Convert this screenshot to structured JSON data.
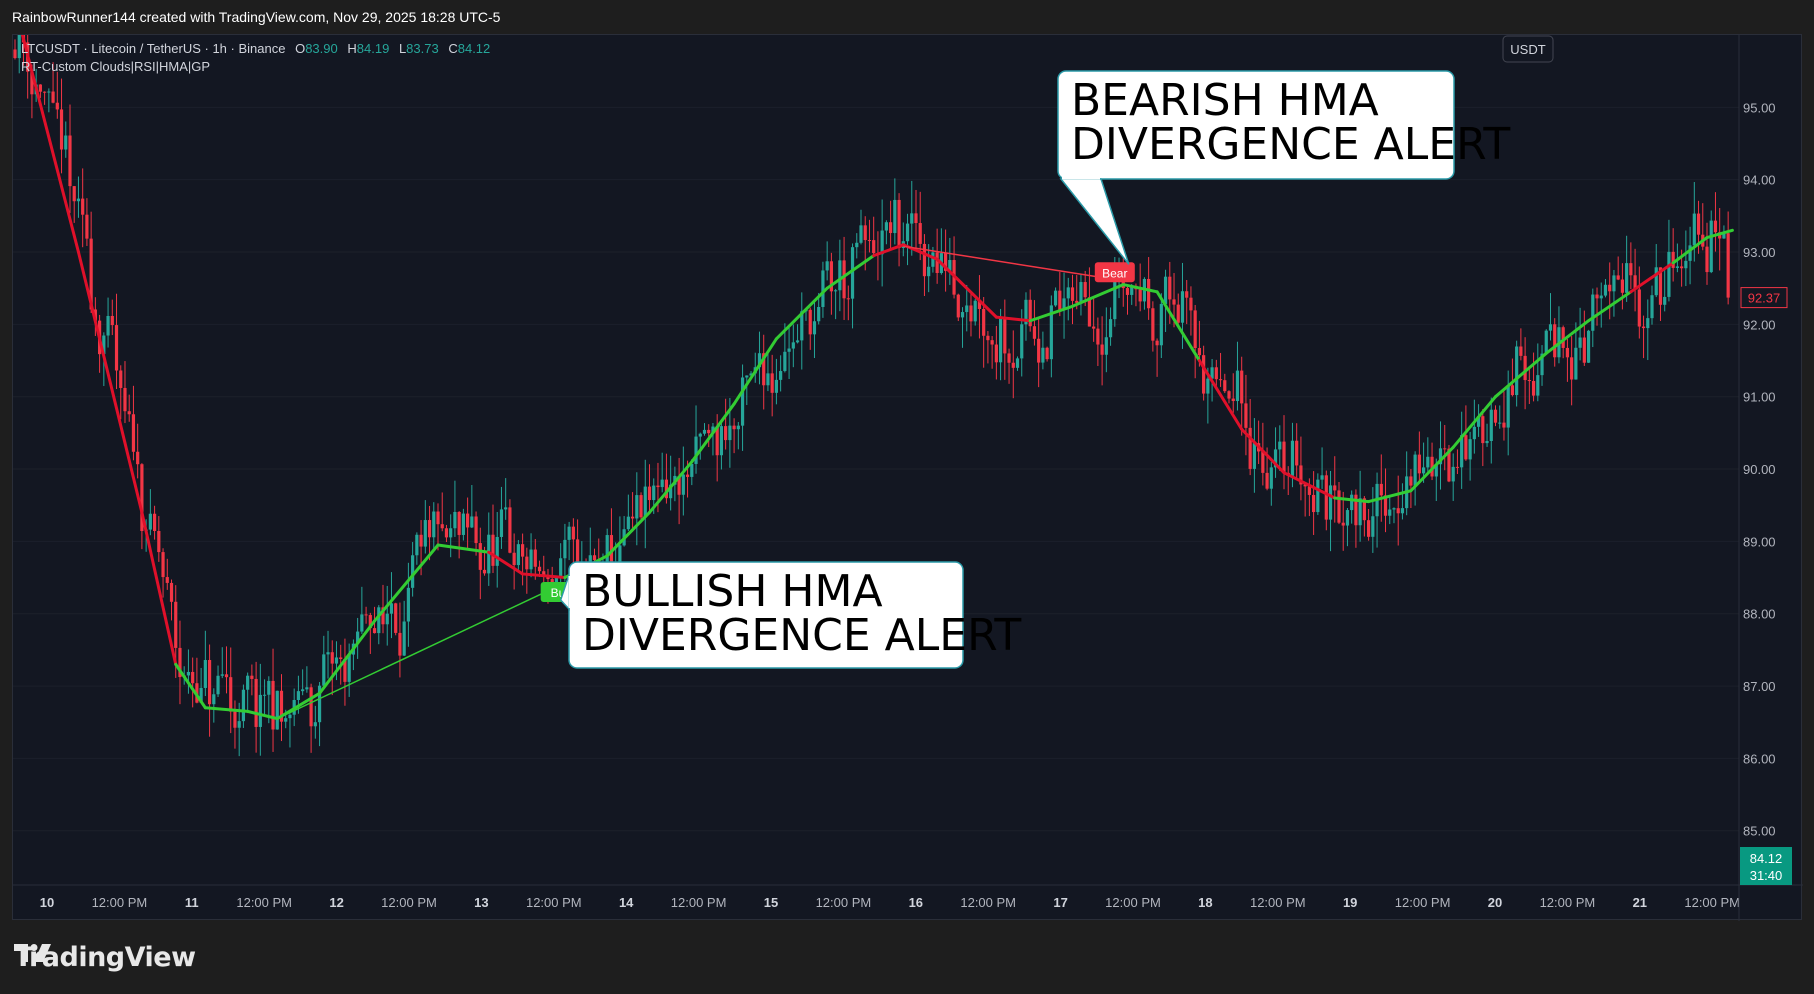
{
  "credit": "RainbowRunner144 created with TradingView.com, Nov 29, 2025 18:28 UTC-5",
  "branding": "TradingView",
  "chart_data": {
    "type": "candlestick",
    "symbol_line": {
      "name": "LTCUSDT · Litecoin / TetherUS · 1h · Binance",
      "o_label": "O",
      "o": "83.90",
      "h_label": "H",
      "h": "84.19",
      "l_label": "L",
      "l": "83.73",
      "c_label": "C",
      "c": "84.12"
    },
    "indicator": "RT-Custom Clouds|RSI|HMA|GP",
    "currency": "USDT",
    "ylim": [
      84.25,
      96.0
    ],
    "y_ticks": [
      "95.00",
      "94.00",
      "93.00",
      "92.00",
      "91.00",
      "90.00",
      "89.00",
      "88.00",
      "87.00",
      "86.00",
      "85.00"
    ],
    "x_ticks": [
      "10",
      "12:00 PM",
      "11",
      "12:00 PM",
      "12",
      "12:00 PM",
      "13",
      "12:00 PM",
      "14",
      "12:00 PM",
      "15",
      "12:00 PM",
      "16",
      "12:00 PM",
      "17",
      "12:00 PM",
      "18",
      "12:00 PM",
      "19",
      "12:00 PM",
      "20",
      "12:00 PM",
      "21",
      "12:00 PM"
    ],
    "price_label": "92.37",
    "last_price": "84.12",
    "countdown": "31:40",
    "colors": {
      "up": "#26a69a",
      "down": "#f23645",
      "hma_bull": "#33cc33",
      "hma_bear": "#e0102a",
      "bg": "#131722"
    },
    "hma_points": [
      [
        0,
        96.4
      ],
      [
        15,
        93.0
      ],
      [
        30,
        89.4
      ],
      [
        38,
        87.3
      ],
      [
        45,
        86.7
      ],
      [
        55,
        86.65
      ],
      [
        62,
        86.55
      ],
      [
        72,
        86.9
      ],
      [
        85,
        87.9
      ],
      [
        100,
        88.95
      ],
      [
        112,
        88.85
      ],
      [
        120,
        88.55
      ],
      [
        130,
        88.5
      ],
      [
        140,
        88.8
      ],
      [
        150,
        89.4
      ],
      [
        160,
        90.1
      ],
      [
        170,
        90.9
      ],
      [
        180,
        91.8
      ],
      [
        192,
        92.5
      ],
      [
        203,
        92.95
      ],
      [
        210,
        93.1
      ],
      [
        218,
        92.9
      ],
      [
        232,
        92.1
      ],
      [
        240,
        92.05
      ],
      [
        250,
        92.25
      ],
      [
        262,
        92.55
      ],
      [
        270,
        92.45
      ],
      [
        280,
        91.5
      ],
      [
        290,
        90.55
      ],
      [
        300,
        89.95
      ],
      [
        312,
        89.6
      ],
      [
        320,
        89.55
      ],
      [
        330,
        89.7
      ],
      [
        340,
        90.3
      ],
      [
        350,
        91.0
      ],
      [
        362,
        91.6
      ],
      [
        372,
        92.05
      ],
      [
        382,
        92.45
      ],
      [
        392,
        92.85
      ],
      [
        400,
        93.2
      ],
      [
        406,
        93.3
      ]
    ],
    "hma_colors": [
      "bear",
      "bear",
      "bear",
      "bull",
      "bull",
      "bull",
      "bull",
      "bull",
      "bull",
      "bull",
      "bear",
      "bear",
      "bull",
      "bull",
      "bull",
      "bull",
      "bull",
      "bull",
      "bull",
      "bear",
      "bear",
      "bear",
      "bear",
      "bull",
      "bull",
      "bull",
      "bull",
      "bear",
      "bear",
      "bear",
      "bull",
      "bull",
      "bull",
      "bull",
      "bull",
      "bull",
      "bull",
      "bear",
      "bull",
      "bull",
      "bear"
    ],
    "signals": [
      {
        "label": "Bull",
        "bar": 129,
        "price": 88.3,
        "color": "#33cc33"
      },
      {
        "label": "Bear",
        "bar": 260,
        "price": 92.72,
        "color": "#f23645"
      }
    ],
    "divergence_lines": [
      {
        "from": [
          62,
          86.55
        ],
        "to": [
          129,
          88.4
        ],
        "color": "#33cc33"
      },
      {
        "from": [
          210,
          93.08
        ],
        "to": [
          260,
          92.62
        ],
        "color": "#f23645"
      }
    ],
    "callouts": [
      {
        "lines": [
          "BULLISH HMA",
          "DIVERGENCE ALERT"
        ]
      },
      {
        "lines": [
          "BEARISH HMA",
          "DIVERGENCE ALERT"
        ]
      }
    ]
  }
}
